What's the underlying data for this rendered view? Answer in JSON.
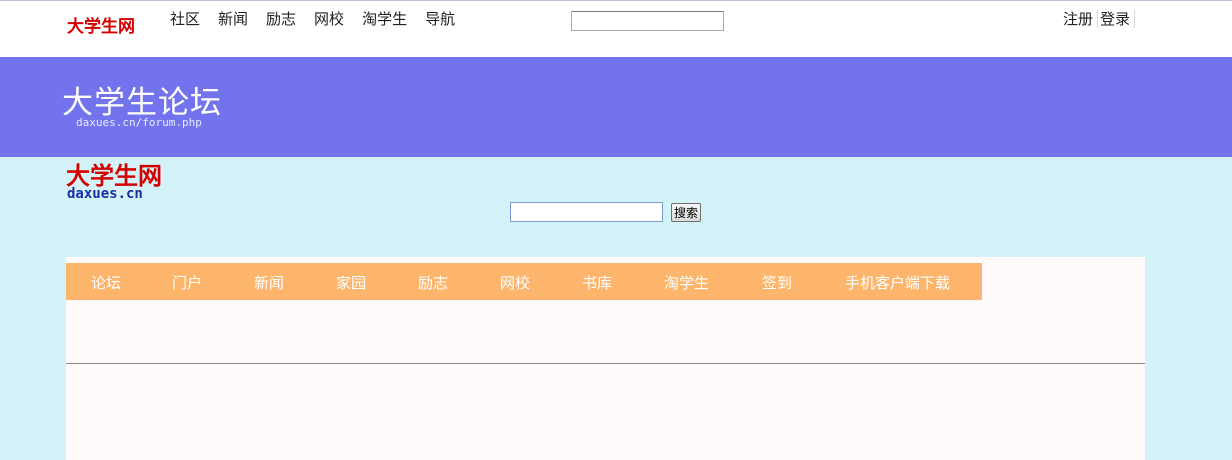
{
  "topbar": {
    "logo": "大学生网",
    "nav": [
      "社区",
      "新闻",
      "励志",
      "网校",
      "淘学生",
      "导航"
    ],
    "search_value": "",
    "auth": [
      "注册",
      "登录"
    ]
  },
  "banner": {
    "title": "大学生论坛",
    "url": "daxues.cn/forum.php"
  },
  "site": {
    "logo": "大学生网",
    "domain": "daxues.cn"
  },
  "search": {
    "value": "",
    "button": "搜索"
  },
  "menu": [
    "论坛",
    "门户",
    "新闻",
    "家园",
    "励志",
    "网校",
    "书库",
    "淘学生",
    "签到",
    "手机客户端下载"
  ],
  "colors": {
    "page_bg": "#d3f3f9",
    "banner_bg": "#7373ee",
    "menu_bg": "#fdb56c",
    "logo_red": "#d40000",
    "domain_blue": "#1b2ea5"
  }
}
